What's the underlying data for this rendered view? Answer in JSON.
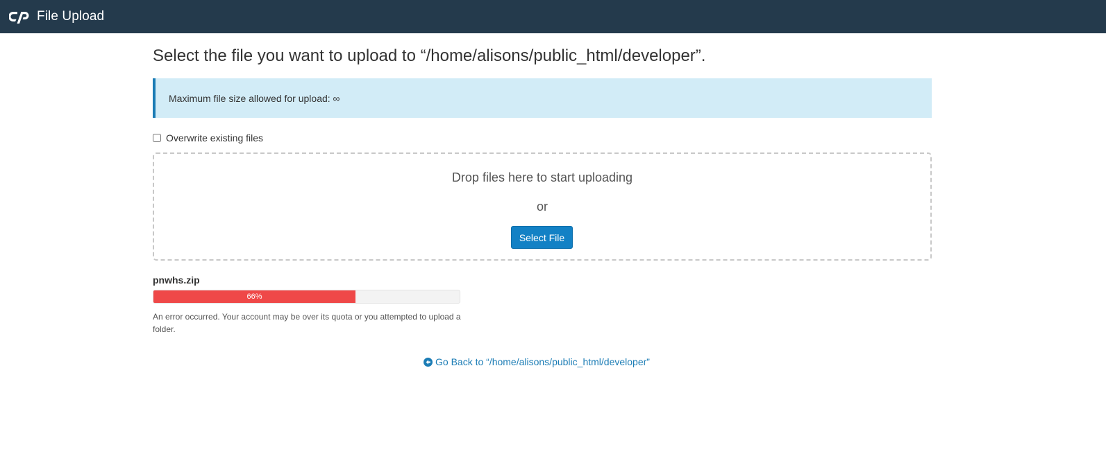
{
  "header": {
    "logo_icon": "cpanel-logo-icon",
    "title": "File Upload",
    "background": "#243a4c"
  },
  "main": {
    "title": "Select the file you want to upload to “/home/alisons/public_html/developer”.",
    "info": {
      "text": "Maximum file size allowed for upload: ∞",
      "background": "#d2ecf7",
      "accent": "#1b7cb5"
    },
    "overwrite": {
      "label": "Overwrite existing files",
      "checked": false
    },
    "dropzone": {
      "drop_text": "Drop files here to start uploading",
      "or_text": "or",
      "select_button": "Select File",
      "button_color": "#1381c5"
    },
    "upload": {
      "file_name": "pnwhs.zip",
      "progress_percent": 66,
      "progress_label": "66%",
      "progress_color": "#ef4848",
      "error_message": "An error occurred. Your account may be over its quota or you attempted to upload a folder."
    },
    "go_back": {
      "icon": "arrow-circle-left-icon",
      "label": "Go Back to “/home/alisons/public_html/developer”",
      "color": "#1b7cb5"
    }
  }
}
